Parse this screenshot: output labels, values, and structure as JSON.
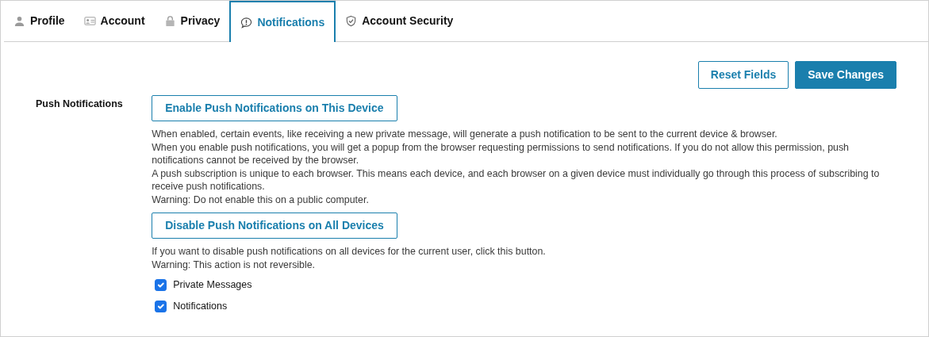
{
  "tabs": [
    {
      "label": "Profile",
      "selected": false
    },
    {
      "label": "Account",
      "selected": false
    },
    {
      "label": "Privacy",
      "selected": false
    },
    {
      "label": "Notifications",
      "selected": true
    },
    {
      "label": "Account Security",
      "selected": false
    }
  ],
  "actions": [
    {
      "label": "Reset Fields",
      "kind": "outline"
    },
    {
      "label": "Save Changes",
      "kind": "primary"
    }
  ],
  "section": {
    "label": "Push Notifications",
    "blocks": [
      {
        "button": "Enable Push Notifications on This Device",
        "lines": [
          "When enabled, certain events, like receiving a new private message, will generate a push notification to be sent to the current device & browser.",
          "When you enable push notifications, you will get a popup from the browser requesting permissions to send notifications. If you do not allow this permission, push notifications cannot be received by the browser.",
          "A push subscription is unique to each browser. This means each device, and each browser on a given device must individually go through this process of subscribing to receive push notifications.",
          "Warning: Do not enable this on a public computer."
        ]
      },
      {
        "button": "Disable Push Notifications on All Devices",
        "lines": [
          "If you want to disable push notifications on all devices for the current user, click this button.",
          "Warning: This action is not reversible."
        ]
      }
    ],
    "options": [
      {
        "label": "Private Messages",
        "checked": true
      },
      {
        "label": "Notifications",
        "checked": true
      }
    ]
  }
}
